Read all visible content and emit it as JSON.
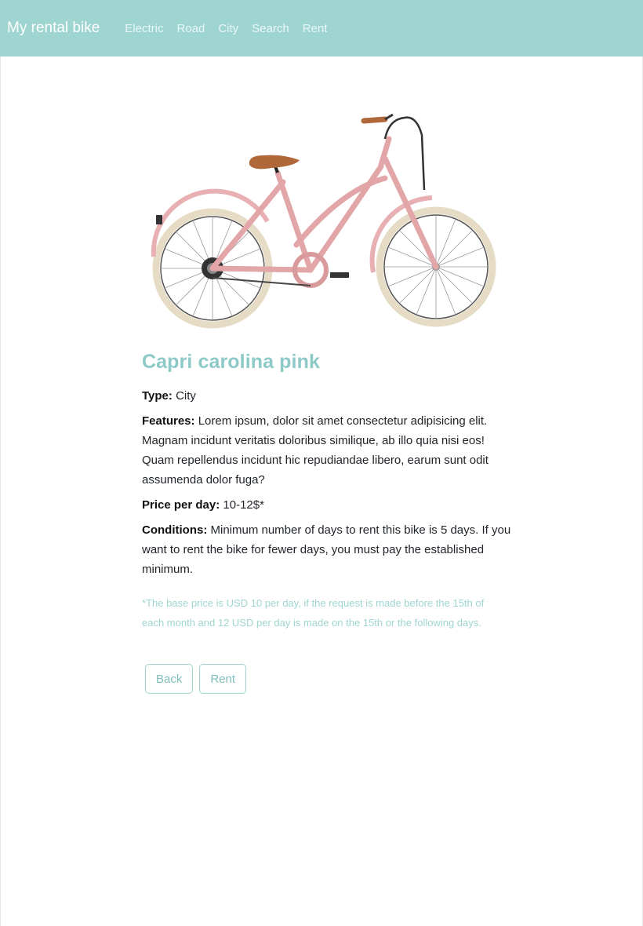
{
  "navbar": {
    "brand": "My rental bike",
    "links": [
      "Electric",
      "Road",
      "City",
      "Search",
      "Rent"
    ],
    "background": "#9fd5d1"
  },
  "product": {
    "image_alt": "pink city bicycle",
    "name": "Capri carolina pink",
    "type_label": "Type:",
    "type_value": "City",
    "features_label": "Features:",
    "features_value": "Lorem ipsum, dolor sit amet consectetur adipisicing elit. Magnam incidunt veritatis doloribus similique, ab illo quia nisi eos! Quam repellendus incidunt hic repudiandae libero, earum sunt odit assumenda dolor fuga?",
    "price_label": "Price per day:",
    "price_value": "10-12$*",
    "conditions_label": "Conditions:",
    "conditions_value": "Minimum number of days to rent this bike is 5 days. If you want to rent the bike for fewer days, you must pay the established minimum.",
    "note": "*The base price is USD 10 per day, if the request is made before the 15th of each month and 12 USD per day is made on the 15th or the following days."
  },
  "actions": {
    "back_label": "Back",
    "rent_label": "Rent"
  },
  "colors": {
    "accent": "#9fd5d1",
    "title": "#8cc9c7",
    "bike_frame": "#e3a6a8",
    "saddle": "#b0683a",
    "tire": "#e7dcc6"
  }
}
